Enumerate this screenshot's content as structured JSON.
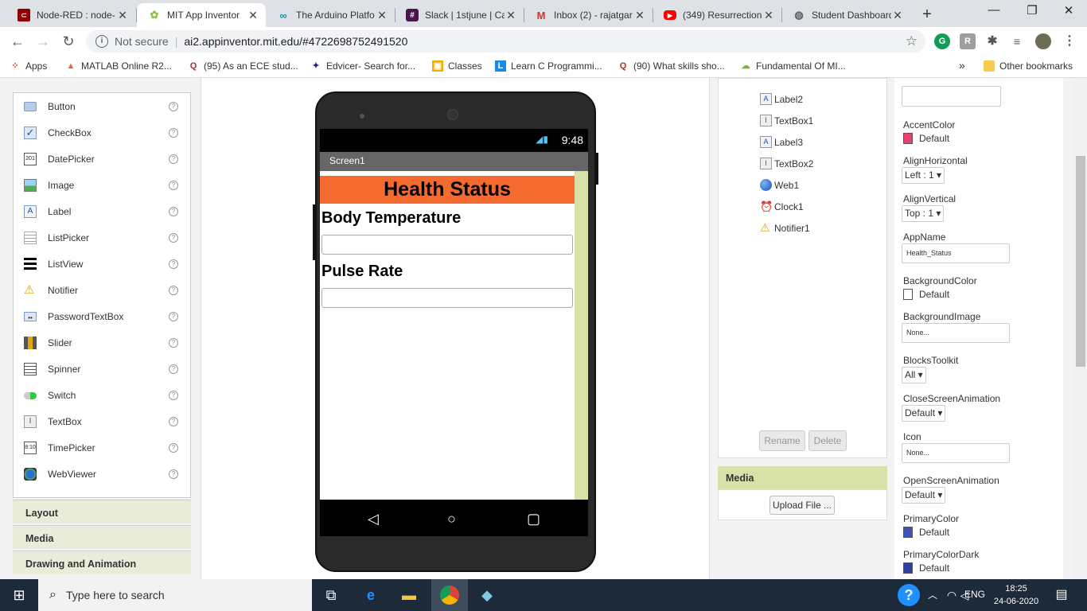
{
  "browser": {
    "tabs": [
      {
        "title": "Node-RED : node-",
        "icon": "node-red-icon"
      },
      {
        "title": "MIT App Inventor",
        "icon": "app-inventor-icon"
      },
      {
        "title": "The Arduino Platfo",
        "icon": "arduino-icon"
      },
      {
        "title": "Slack | 1stjune | Ca",
        "icon": "slack-icon"
      },
      {
        "title": "Inbox (2) - rajatgar",
        "icon": "gmail-icon"
      },
      {
        "title": "(349) Resurrection",
        "icon": "youtube-icon"
      },
      {
        "title": "Student Dashboard",
        "icon": "globe-icon"
      }
    ],
    "security": "Not secure",
    "url": "ai2.appinventor.mit.edu/#4722698752491520",
    "bookmarks": [
      {
        "label": "Apps"
      },
      {
        "label": "MATLAB Online R2..."
      },
      {
        "label": "(95) As an ECE stud..."
      },
      {
        "label": "Edvicer- Search for..."
      },
      {
        "label": "Classes"
      },
      {
        "label": "Learn C Programmi..."
      },
      {
        "label": "(90) What skills sho..."
      },
      {
        "label": "Fundamental Of MI..."
      }
    ],
    "overflow": "»",
    "other_bookmarks": "Other bookmarks"
  },
  "palette": {
    "items": [
      {
        "label": "Button",
        "icon": "button-icon"
      },
      {
        "label": "CheckBox",
        "icon": "checkbox-icon"
      },
      {
        "label": "DatePicker",
        "icon": "datepicker-icon"
      },
      {
        "label": "Image",
        "icon": "image-icon"
      },
      {
        "label": "Label",
        "icon": "label-icon"
      },
      {
        "label": "ListPicker",
        "icon": "listpicker-icon"
      },
      {
        "label": "ListView",
        "icon": "listview-icon"
      },
      {
        "label": "Notifier",
        "icon": "notifier-icon"
      },
      {
        "label": "PasswordTextBox",
        "icon": "password-icon"
      },
      {
        "label": "Slider",
        "icon": "slider-icon"
      },
      {
        "label": "Spinner",
        "icon": "spinner-icon"
      },
      {
        "label": "Switch",
        "icon": "switch-icon"
      },
      {
        "label": "TextBox",
        "icon": "textbox-icon"
      },
      {
        "label": "TimePicker",
        "icon": "timepicker-icon"
      },
      {
        "label": "WebViewer",
        "icon": "webviewer-icon"
      }
    ],
    "help": "?",
    "categories": [
      "Layout",
      "Media",
      "Drawing and Animation"
    ]
  },
  "phone": {
    "time": "9:48",
    "screen_title": "Screen1",
    "heading": "Health Status",
    "label1": "Body Temperature",
    "label2": "Pulse Rate",
    "heading_color": "#f56a2e",
    "nav": [
      "◁",
      "○",
      "▢"
    ]
  },
  "components": {
    "items": [
      {
        "label": "Label2",
        "icon": "label-icon"
      },
      {
        "label": "TextBox1",
        "icon": "textbox-icon"
      },
      {
        "label": "Label3",
        "icon": "label-icon"
      },
      {
        "label": "TextBox2",
        "icon": "textbox-icon"
      },
      {
        "label": "Web1",
        "icon": "globe-icon"
      },
      {
        "label": "Clock1",
        "icon": "clock-icon"
      },
      {
        "label": "Notifier1",
        "icon": "notifier-icon"
      }
    ],
    "rename": "Rename",
    "delete": "Delete"
  },
  "media": {
    "title": "Media",
    "upload": "Upload File ..."
  },
  "properties": {
    "accent_color": {
      "label": "AccentColor",
      "value": "Default",
      "color": "#e8416f"
    },
    "align_horizontal": {
      "label": "AlignHorizontal",
      "value": "Left : 1 ▾"
    },
    "align_vertical": {
      "label": "AlignVertical",
      "value": "Top : 1 ▾"
    },
    "app_name": {
      "label": "AppName",
      "value": "Health_Status"
    },
    "background_color": {
      "label": "BackgroundColor",
      "value": "Default",
      "color": "#ffffff"
    },
    "background_image": {
      "label": "BackgroundImage",
      "value": "None..."
    },
    "blocks_toolkit": {
      "label": "BlocksToolkit",
      "value": "All ▾"
    },
    "close_anim": {
      "label": "CloseScreenAnimation",
      "value": "Default ▾"
    },
    "icon": {
      "label": "Icon",
      "value": "None..."
    },
    "open_anim": {
      "label": "OpenScreenAnimation",
      "value": "Default ▾"
    },
    "primary_color": {
      "label": "PrimaryColor",
      "value": "Default",
      "color": "#3f51b5"
    },
    "primary_color_dark": {
      "label": "PrimaryColorDark",
      "value": "Default",
      "color": "#303f9f"
    }
  },
  "taskbar": {
    "search": "Type here to search",
    "lang": "ENG",
    "time": "18:25",
    "date": "24-06-2020"
  }
}
